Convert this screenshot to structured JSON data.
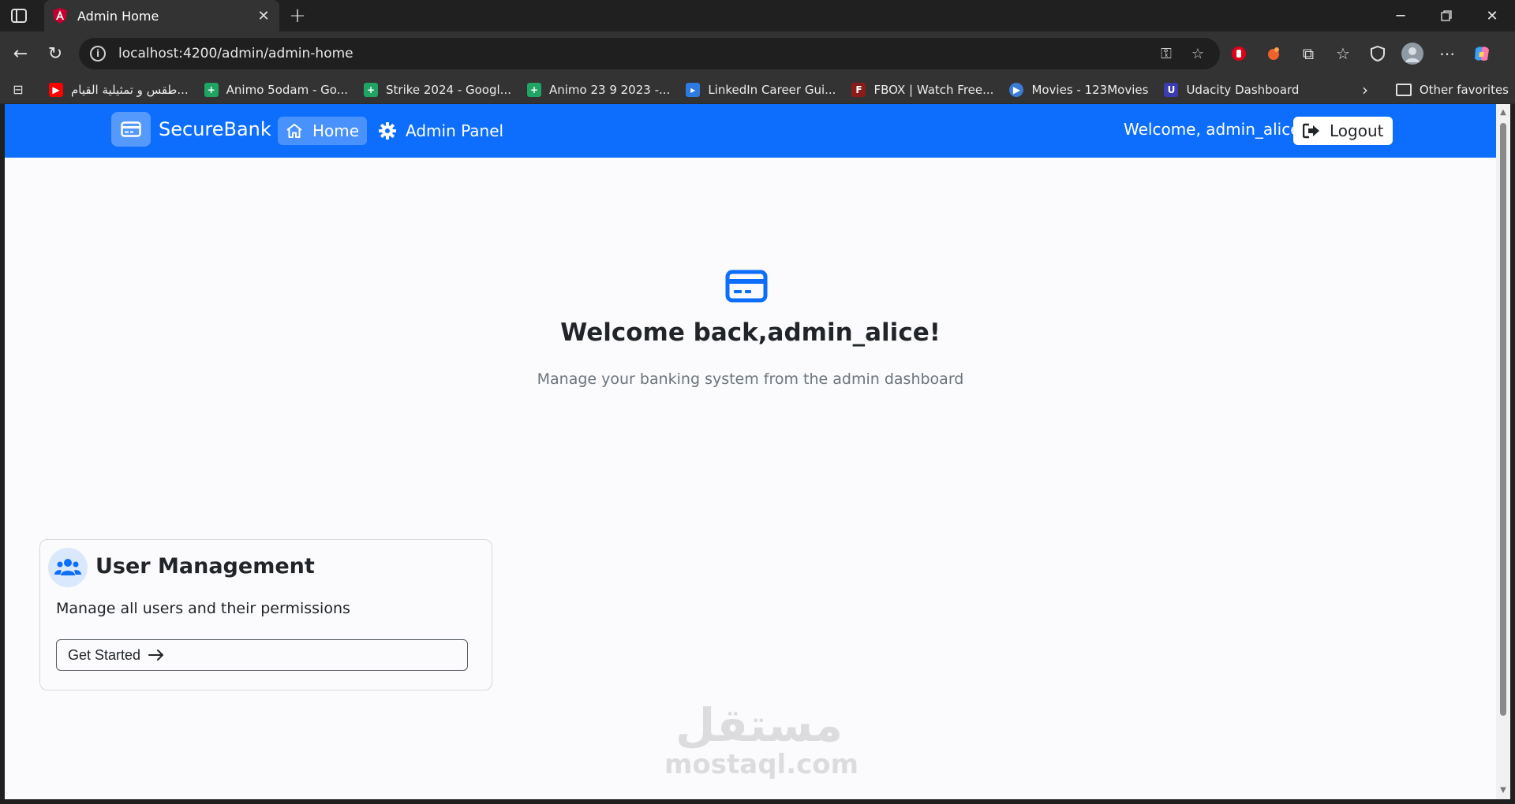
{
  "browser": {
    "tab_title": "Admin Home",
    "url": "localhost:4200/admin/admin-home",
    "bookmarks": [
      {
        "label": "طقس و تمثيلية القيام...",
        "icon": "youtube-icon",
        "color": "#ff0000"
      },
      {
        "label": "Animo 5odam - Go...",
        "icon": "sheets-icon",
        "color": "#1fa463"
      },
      {
        "label": "Strike 2024 - Googl...",
        "icon": "sheets-icon",
        "color": "#1fa463"
      },
      {
        "label": "Animo 23 9 2023 -...",
        "icon": "sheets-icon",
        "color": "#1fa463"
      },
      {
        "label": "LinkedIn Career Gui...",
        "icon": "video-icon",
        "color": "#2d7be0"
      },
      {
        "label": "FBOX | Watch Free...",
        "icon": "fbox-icon",
        "color": "#8b1c1c"
      },
      {
        "label": "Movies - 123Movies",
        "icon": "play-circle-icon",
        "color": "#3a7bd5"
      },
      {
        "label": "Udacity Dashboard",
        "icon": "udacity-icon",
        "color": "#3c3cb0"
      }
    ],
    "other_favorites": "Other favorites"
  },
  "navbar": {
    "brand": "SecureBank",
    "home": "Home",
    "admin_panel": "Admin Panel",
    "welcome": "Welcome, admin_alice",
    "logout": "Logout",
    "color": "#0d6efd"
  },
  "hero": {
    "title": "Welcome back,admin_alice!",
    "subtitle": "Manage your banking system from the admin dashboard"
  },
  "card": {
    "title": "User Management",
    "description": "Manage all users and their permissions",
    "button": "Get Started"
  },
  "watermark": {
    "arabic": "مستقل",
    "latin": "mostaql.com"
  }
}
